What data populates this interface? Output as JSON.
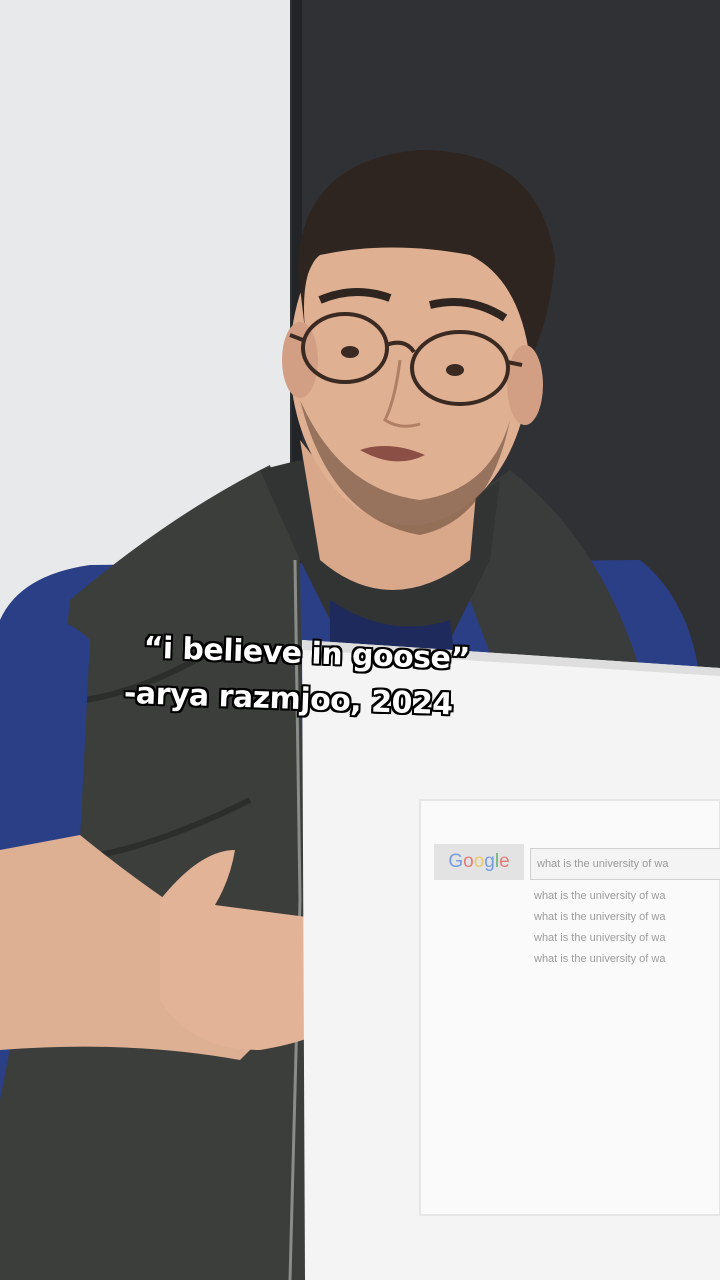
{
  "caption": {
    "quote": "“i believe in goose”",
    "attribution": "-arya razmjoo, 2024"
  },
  "board": {
    "logo": [
      "G",
      "o",
      "o",
      "g",
      "l",
      "e"
    ],
    "logo_colors": [
      "#4b7fd6",
      "#d9534f",
      "#e8b83a",
      "#4b7fd6",
      "#3a9a4e",
      "#d9534f"
    ],
    "query": "what is the university of wa",
    "suggestions": [
      "what is the university of wa",
      "what is the university of wa",
      "what is the university of wa",
      "what is the university of wa"
    ]
  }
}
